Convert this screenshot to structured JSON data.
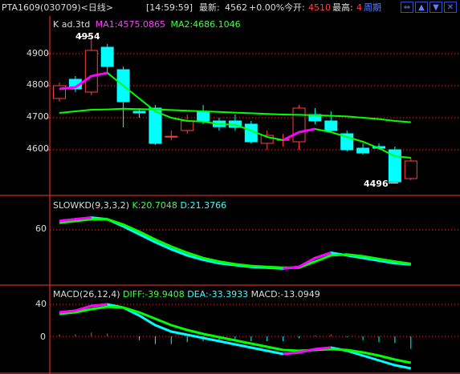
{
  "header": {
    "symbol": "PTA1609",
    "code": "(030709)",
    "period": "<日线>",
    "time": "[14:59:59]",
    "latest_label": "最新:",
    "latest_value": "4562",
    "change": "+0.00%",
    "open_label": "今开:",
    "open_value": "4510",
    "high_label": "最高:",
    "high_value": "4",
    "cycle_button": "周期"
  },
  "toolbar_icons": [
    "restore-icon",
    "arrow-up-icon",
    "arrow-down-icon",
    "close-icon"
  ],
  "colors": {
    "background": "#000000",
    "up_candle": "#ff4040",
    "down_candle": "#00ffff",
    "ma1": "#ff00ff",
    "ma2": "#00ff00",
    "grid": "#ff3030",
    "k_line": "#00ffff",
    "d_line": "#00ff00",
    "diff_line": "#00ffff",
    "dea_line": "#00ff00"
  },
  "main_panel": {
    "title": "K  ad.3td",
    "ma1_label": "MA1:4575.0865",
    "ma2_label": "MA2:4686.1046",
    "y_ticks": [
      "4900",
      "4800",
      "4700",
      "4600"
    ],
    "high_marker": "4954",
    "low_marker": "4496"
  },
  "kd_panel": {
    "title": "SLOWKD(9,3,3,2)",
    "k_label": "K:20.7048",
    "d_label": "D:21.3766",
    "y_ticks": [
      "60"
    ]
  },
  "macd_panel": {
    "title": "MACD(26,12,4)",
    "diff_label": "DIFF:-39.9408",
    "dea_label": "DEA:-33.3933",
    "macd_label": "MACD:-13.0949",
    "y_ticks": [
      "40",
      "0"
    ]
  },
  "chart_data": {
    "type": "candlestick",
    "candles": [
      {
        "o": 4760,
        "c": 4800,
        "h": 4810,
        "l": 4750
      },
      {
        "o": 4820,
        "c": 4790,
        "h": 4830,
        "l": 4780
      },
      {
        "o": 4780,
        "c": 4910,
        "h": 4954,
        "l": 4770
      },
      {
        "o": 4920,
        "c": 4860,
        "h": 4930,
        "l": 4840
      },
      {
        "o": 4850,
        "c": 4750,
        "h": 4860,
        "l": 4670
      },
      {
        "o": 4720,
        "c": 4715,
        "h": 4730,
        "l": 4700
      },
      {
        "o": 4730,
        "c": 4620,
        "h": 4740,
        "l": 4615
      },
      {
        "o": 4640,
        "c": 4642,
        "h": 4660,
        "l": 4630
      },
      {
        "o": 4660,
        "c": 4690,
        "h": 4710,
        "l": 4650
      },
      {
        "o": 4720,
        "c": 4690,
        "h": 4740,
        "l": 4680
      },
      {
        "o": 4690,
        "c": 4672,
        "h": 4700,
        "l": 4660
      },
      {
        "o": 4690,
        "c": 4670,
        "h": 4710,
        "l": 4660
      },
      {
        "o": 4680,
        "c": 4625,
        "h": 4690,
        "l": 4620
      },
      {
        "o": 4620,
        "c": 4645,
        "h": 4660,
        "l": 4600
      },
      {
        "o": 4630,
        "c": 4632,
        "h": 4650,
        "l": 4610
      },
      {
        "o": 4625,
        "c": 4730,
        "h": 4740,
        "l": 4600
      },
      {
        "o": 4710,
        "c": 4690,
        "h": 4730,
        "l": 4680
      },
      {
        "o": 4690,
        "c": 4660,
        "h": 4720,
        "l": 4655
      },
      {
        "o": 4650,
        "c": 4600,
        "h": 4660,
        "l": 4595
      },
      {
        "o": 4605,
        "c": 4590,
        "h": 4620,
        "l": 4585
      },
      {
        "o": 4610,
        "c": 4605,
        "h": 4620,
        "l": 4600
      },
      {
        "o": 4600,
        "c": 4500,
        "h": 4610,
        "l": 4496
      },
      {
        "o": 4510,
        "c": 4565,
        "h": 4575,
        "l": 4505
      }
    ],
    "ma1": [
      4790,
      4795,
      4830,
      4840,
      4800,
      4760,
      4720,
      4700,
      4690,
      4688,
      4680,
      4678,
      4660,
      4640,
      4630,
      4655,
      4665,
      4655,
      4640,
      4625,
      4605,
      4580,
      4575
    ],
    "ma2": [
      4715,
      4720,
      4725,
      4726,
      4728,
      4727,
      4726,
      4724,
      4722,
      4720,
      4718,
      4716,
      4714,
      4712,
      4710,
      4709,
      4708,
      4706,
      4704,
      4700,
      4696,
      4690,
      4686
    ],
    "kd_k": [
      70,
      72,
      74,
      72,
      64,
      55,
      46,
      38,
      31,
      26,
      22,
      20,
      18,
      17,
      16,
      18,
      28,
      34,
      31,
      28,
      25,
      22,
      20.7
    ],
    "kd_d": [
      68,
      70,
      72,
      72,
      66,
      58,
      49,
      41,
      34,
      28,
      24,
      21,
      19,
      18,
      17,
      17,
      24,
      31,
      32,
      30,
      27,
      24,
      21.4
    ],
    "macd_diff": [
      30,
      32,
      38,
      40,
      36,
      26,
      14,
      6,
      2,
      -2,
      -6,
      -10,
      -14,
      -18,
      -22,
      -20,
      -16,
      -14,
      -18,
      -24,
      -30,
      -36,
      -40
    ],
    "macd_dea": [
      28,
      30,
      34,
      37,
      36,
      30,
      22,
      14,
      8,
      3,
      -1,
      -5,
      -9,
      -13,
      -17,
      -18,
      -17,
      -16,
      -17,
      -20,
      -24,
      -29,
      -33
    ],
    "macd_bar": [
      2,
      2,
      4,
      3,
      0,
      -4,
      -8,
      -8,
      -6,
      -5,
      -5,
      -5,
      -5,
      -5,
      -5,
      -2,
      1,
      2,
      -1,
      -4,
      -6,
      -7,
      -13
    ]
  }
}
